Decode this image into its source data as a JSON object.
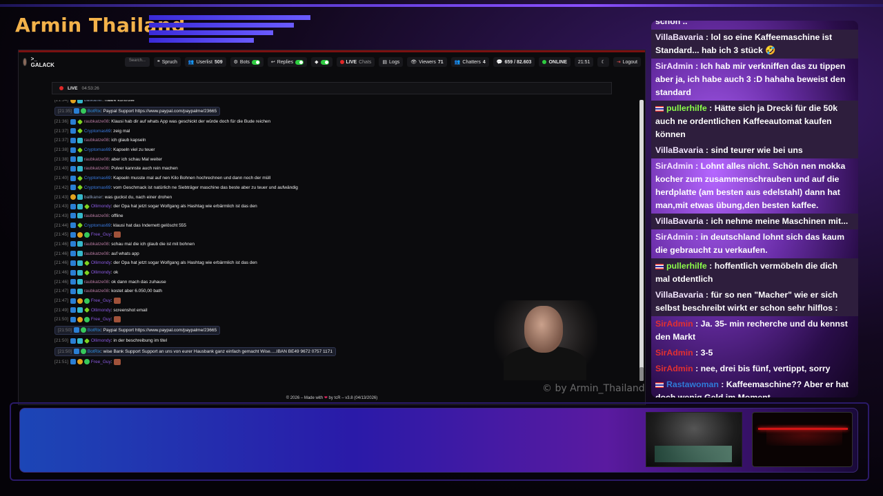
{
  "brand": {
    "title": "Armin Thailand"
  },
  "browser": {
    "app_name": ">_ GALACK",
    "search_placeholder": "Search...",
    "nav": {
      "spruch": "Spruch",
      "userlist_label": "Userlist",
      "userlist_count": "509",
      "bots": "Bots",
      "replies": "Replies",
      "live": "LIVE",
      "chats": "Chats",
      "logs": "Logs",
      "viewers_label": "Viewers",
      "viewers_count": "71",
      "chatters_label": "Chatters",
      "chatters_count": "4",
      "messages": "659 / 82.603",
      "online": "ONLINE",
      "clock": "21:51",
      "logout": "Logout"
    },
    "live_status": {
      "label": "LIVE",
      "duration": "04:53:26"
    },
    "footer": {
      "left": "© 2026 – Made with",
      "right": "by tcR",
      "version": "v3.8 (04/13/2026)"
    },
    "messages": [
      {
        "ts": "[21:34]",
        "user": "ballkaner",
        "user_color": "#8a9bb8",
        "text": ": haare kontrolle",
        "bot": false,
        "badges": [
          "gold",
          "cyan"
        ]
      },
      {
        "ts": "[21:35]",
        "user": "BotRix",
        "user_color": "#2f8fe0",
        "text": ": Paypal Support https://www.paypal.com/paypalme/23665",
        "bot": true,
        "badges": [
          "blue",
          "green"
        ]
      },
      {
        "ts": "[21:36]",
        "user": "raubkatze08",
        "user_color": "#b57aa0",
        "text": ": Klausi hab dir auf whats App was geschickt der würde doch für die Bude reichen",
        "bot": false,
        "badges": [
          "blue",
          "lime"
        ]
      },
      {
        "ts": "[21:37]",
        "user": "Cryptomas69",
        "user_color": "#3a7ae0",
        "text": ": zeig mal",
        "bot": false,
        "badges": [
          "blue",
          "lime"
        ]
      },
      {
        "ts": "[21:37]",
        "user": "raubkatze08",
        "user_color": "#b57aa0",
        "text": ": ich glaub kapseln",
        "bot": false,
        "badges": [
          "blue",
          "cyan"
        ]
      },
      {
        "ts": "[21:38]",
        "user": "Cryptomas69",
        "user_color": "#3a7ae0",
        "text": ": Kapseln viel zu teuer",
        "bot": false,
        "badges": [
          "blue",
          "lime"
        ]
      },
      {
        "ts": "[21:38]",
        "user": "raubkatze08",
        "user_color": "#b57aa0",
        "text": ": aber ich schau Mal weiter",
        "bot": false,
        "badges": [
          "blue",
          "cyan"
        ]
      },
      {
        "ts": "[21:40]",
        "user": "raubkatze08",
        "user_color": "#b57aa0",
        "text": ": Pulver kannste auch rein machen",
        "bot": false,
        "badges": [
          "blue",
          "cyan"
        ]
      },
      {
        "ts": "[21:40]",
        "user": "Cryptomas69",
        "user_color": "#3a7ae0",
        "text": ": Kapseln musste mal auf nen Kilo Bohnen hochrechnen und dann noch der müll",
        "bot": false,
        "badges": [
          "blue",
          "lime"
        ]
      },
      {
        "ts": "[21:42]",
        "user": "Cryptomas69",
        "user_color": "#3a7ae0",
        "text": ": vom Geschmack ist natürlich ne Siebträger maschine das beste aber zu teuer und aufwändig",
        "bot": false,
        "badges": [
          "blue",
          "lime"
        ]
      },
      {
        "ts": "[21:43]",
        "user": "ballkaner",
        "user_color": "#8a9bb8",
        "text": ": was guckst du, nach einer drohen",
        "bot": false,
        "badges": [
          "gold",
          "cyan"
        ]
      },
      {
        "ts": "[21:43]",
        "user": "Ollimondy",
        "user_color": "#8a5ae0",
        "text": ": der Opa hat jetzt sogar Wolfgang als Hashtag wie erbärmlich ist das den",
        "bot": false,
        "badges": [
          "blue",
          "cyan",
          "lime"
        ]
      },
      {
        "ts": "[21:43]",
        "user": "raubkatze08",
        "user_color": "#b57aa0",
        "text": ": offline",
        "bot": false,
        "badges": [
          "blue",
          "cyan"
        ]
      },
      {
        "ts": "[21:44]",
        "user": "Cryptomas69",
        "user_color": "#3a7ae0",
        "text": ": klausi hat das Indernett gelöscht 555",
        "bot": false,
        "badges": [
          "blue",
          "lime"
        ]
      },
      {
        "ts": "[21:45]",
        "user": "Free_Guy",
        "user_color": "#8a5ae0",
        "text": ":",
        "bot": false,
        "badges": [
          "blue",
          "gold",
          "green"
        ],
        "emote": true
      },
      {
        "ts": "[21:46]",
        "user": "raubkatze08",
        "user_color": "#b57aa0",
        "text": ": schau mal die ich glaub die ist mit bohnen",
        "bot": false,
        "badges": [
          "blue",
          "cyan"
        ]
      },
      {
        "ts": "[21:46]",
        "user": "raubkatze08",
        "user_color": "#b57aa0",
        "text": ": auf whats app",
        "bot": false,
        "badges": [
          "blue",
          "cyan"
        ]
      },
      {
        "ts": "[21:46]",
        "user": "Ollimondy",
        "user_color": "#8a5ae0",
        "text": ": der Opa hat jetzt sogar Wolfgang als Hashtag wie erbärmlich ist das den",
        "bot": false,
        "badges": [
          "blue",
          "cyan",
          "lime"
        ]
      },
      {
        "ts": "[21:46]",
        "user": "Ollimondy",
        "user_color": "#8a5ae0",
        "text": ": ok",
        "bot": false,
        "badges": [
          "blue",
          "cyan",
          "lime"
        ]
      },
      {
        "ts": "[21:46]",
        "user": "raubkatze08",
        "user_color": "#b57aa0",
        "text": ": ok dann mach das zuhause",
        "bot": false,
        "badges": [
          "blue",
          "cyan"
        ]
      },
      {
        "ts": "[21:47]",
        "user": "raubkatze08",
        "user_color": "#b57aa0",
        "text": ": kostet aber 6.050,00 bath",
        "bot": false,
        "badges": [
          "blue",
          "cyan"
        ]
      },
      {
        "ts": "[21:47]",
        "user": "Free_Guy",
        "user_color": "#8a5ae0",
        "text": ":",
        "bot": false,
        "badges": [
          "blue",
          "gold",
          "green"
        ],
        "emote": true
      },
      {
        "ts": "[21:49]",
        "user": "Ollimondy",
        "user_color": "#8a5ae0",
        "text": ": screenshot email",
        "bot": false,
        "badges": [
          "blue",
          "cyan",
          "lime"
        ]
      },
      {
        "ts": "[21:50]",
        "user": "Free_Guy",
        "user_color": "#8a5ae0",
        "text": ":",
        "bot": false,
        "badges": [
          "blue",
          "gold",
          "green"
        ],
        "emote": true
      },
      {
        "ts": "[21:50]",
        "user": "BotRix",
        "user_color": "#2f8fe0",
        "text": ": Paypal Support https://www.paypal.com/paypalme/23665",
        "bot": true,
        "badges": [
          "blue",
          "green"
        ]
      },
      {
        "ts": "[21:50]",
        "user": "Ollimondy",
        "user_color": "#8a5ae0",
        "text": ": in der beschreibung im titel",
        "bot": false,
        "badges": [
          "blue",
          "cyan",
          "lime"
        ]
      },
      {
        "ts": "[21:50]",
        "user": "BotRix",
        "user_color": "#2f8fe0",
        "text": ": wise Bank Support Support an uns von eurer Hausbank ganz einfach gemacht Wise.....IBAN BE49 9672 0757 1171",
        "bot": true,
        "badges": [
          "blue",
          "green"
        ]
      },
      {
        "ts": "[21:51]",
        "user": "Free_Guy",
        "user_color": "#8a5ae0",
        "text": ":",
        "bot": false,
        "badges": [
          "blue",
          "gold",
          "green"
        ],
        "emote": true
      }
    ]
  },
  "watermark": "© by Armin_Thailand",
  "side_chat": [
    {
      "user": "",
      "text": "schon ..",
      "name_class": "n-villa",
      "box": false,
      "flag": false
    },
    {
      "user": "VillaBavaria",
      "text": " : lol so eine Kaffeemaschine ist Standard... hab ich 3 stück 🤣",
      "name_class": "n-villa",
      "box": true,
      "flag": false
    },
    {
      "user": "SirAdmin",
      "text": " : Ich hab mir verkniffen das zu tippen aber ja, ich habe auch 3 :D hahaha beweist den standard",
      "name_class": "n-sir",
      "box": false,
      "flag": false
    },
    {
      "user": "pullerhilfe",
      "text": " : Hätte sich ja Drecki für die 50k auch ne ordentlichen Kaffeeautomat kaufen können",
      "name_class": "n-puller",
      "box": true,
      "flag": true
    },
    {
      "user": "VillaBavaria",
      "text": " : sind teurer wie bei uns",
      "name_class": "n-villa",
      "box": true,
      "flag": false
    },
    {
      "user": "SirAdmin",
      "text": " : Lohnt alles nicht. Schön nen mokka kocher zum zusammenschrauben und auf die herdplatte (am besten aus edelstahl) dann hat man,mit etwas übung,den besten kaffee.",
      "name_class": "n-sir",
      "box": false,
      "flag": false
    },
    {
      "user": "VillaBavaria",
      "text": " : ich nehme meine Maschinen mit...",
      "name_class": "n-villa",
      "box": true,
      "flag": false
    },
    {
      "user": "SirAdmin",
      "text": " : in deutschland lohnt sich das kaum die gebraucht zu verkaufen.",
      "name_class": "n-sir",
      "box": false,
      "flag": false
    },
    {
      "user": "pullerhilfe",
      "text": " : hoffentlich vermöbeln die dich mal otdentlich",
      "name_class": "n-puller",
      "box": true,
      "flag": true
    },
    {
      "user": "VillaBavaria",
      "text": " : für so nen \"Macher\" wie er sich selbst beschreibt wirkt er schon sehr hilflos :",
      "name_class": "n-villa",
      "box": true,
      "flag": false
    },
    {
      "user": "SirAdmin",
      "text": " : Ja. 35- min recherche und du kennst den Markt",
      "name_class": "n-red",
      "box": false,
      "flag": false
    },
    {
      "user": "SirAdmin",
      "text": " : 3-5",
      "name_class": "n-red",
      "box": false,
      "flag": false
    },
    {
      "user": "SirAdmin",
      "text": " : nee, drei bis fünf, vertippt, sorry",
      "name_class": "n-red",
      "box": false,
      "flag": false
    },
    {
      "user": "Rastawoman",
      "text": " : Kaffeemaschine?? Aber er hat doch wenig Geld im Moment",
      "name_class": "n-rasta",
      "box": false,
      "flag": true
    }
  ]
}
